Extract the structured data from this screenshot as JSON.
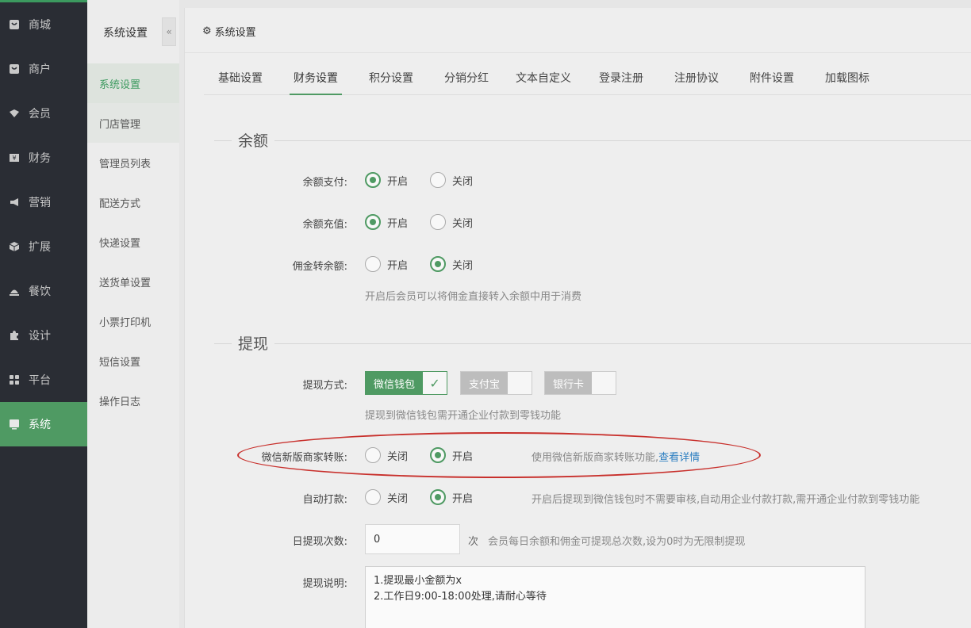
{
  "nav": {
    "items": [
      {
        "label": "商城",
        "icon": "shop-icon"
      },
      {
        "label": "商户",
        "icon": "merchant-icon"
      },
      {
        "label": "会员",
        "icon": "member-icon"
      },
      {
        "label": "财务",
        "icon": "finance-icon"
      },
      {
        "label": "营销",
        "icon": "megaphone-icon"
      },
      {
        "label": "扩展",
        "icon": "cube-icon"
      },
      {
        "label": "餐饮",
        "icon": "dining-icon"
      },
      {
        "label": "设计",
        "icon": "puzzle-icon"
      },
      {
        "label": "平台",
        "icon": "grid-icon"
      },
      {
        "label": "系统",
        "icon": "system-icon"
      }
    ],
    "active": "系统",
    "accent": "#4f9a63"
  },
  "subnav": {
    "title": "系统设置",
    "collapse": "«",
    "items": [
      "系统设置",
      "门店管理",
      "管理员列表",
      "配送方式",
      "快递设置",
      "送货单设置",
      "小票打印机",
      "短信设置",
      "操作日志"
    ]
  },
  "page": {
    "title": "系统设置",
    "tabs": [
      "基础设置",
      "财务设置",
      "积分设置",
      "分销分红",
      "文本自定义",
      "登录注册",
      "注册协议",
      "附件设置",
      "加载图标"
    ],
    "active_tab": "财务设置"
  },
  "balance": {
    "section": "余额",
    "pay_label": "余额支付:",
    "recharge_label": "余额充值:",
    "commission_label": "佣金转余额:",
    "on": "开启",
    "off": "关闭",
    "commission_hint": "开启后会员可以将佣金直接转入余额中用于消费"
  },
  "withdraw": {
    "section": "提现",
    "method_label": "提现方式:",
    "methods": [
      "微信钱包",
      "支付宝",
      "银行卡"
    ],
    "method_hint": "提现到微信钱包需开通企业付款到零钱功能",
    "wx_transfer_label": "微信新版商家转账:",
    "off": "关闭",
    "on": "开启",
    "wx_transfer_hint": "使用微信新版商家转账功能,",
    "wx_transfer_link": "查看详情",
    "auto_pay_label": "自动打款:",
    "auto_pay_hint": "开启后提现到微信钱包时不需要审核,自动用企业付款打款,需开通企业付款到零钱功能",
    "daily_count_label": "日提现次数:",
    "daily_count_value": "0",
    "daily_count_unit": "次",
    "daily_count_hint": "会员每日余额和佣金可提现总次数,设为0时为无限制提现",
    "desc_label": "提现说明:",
    "desc_value": "1.提现最小金额为x\n2.工作日9:00-18:00处理,请耐心等待"
  }
}
